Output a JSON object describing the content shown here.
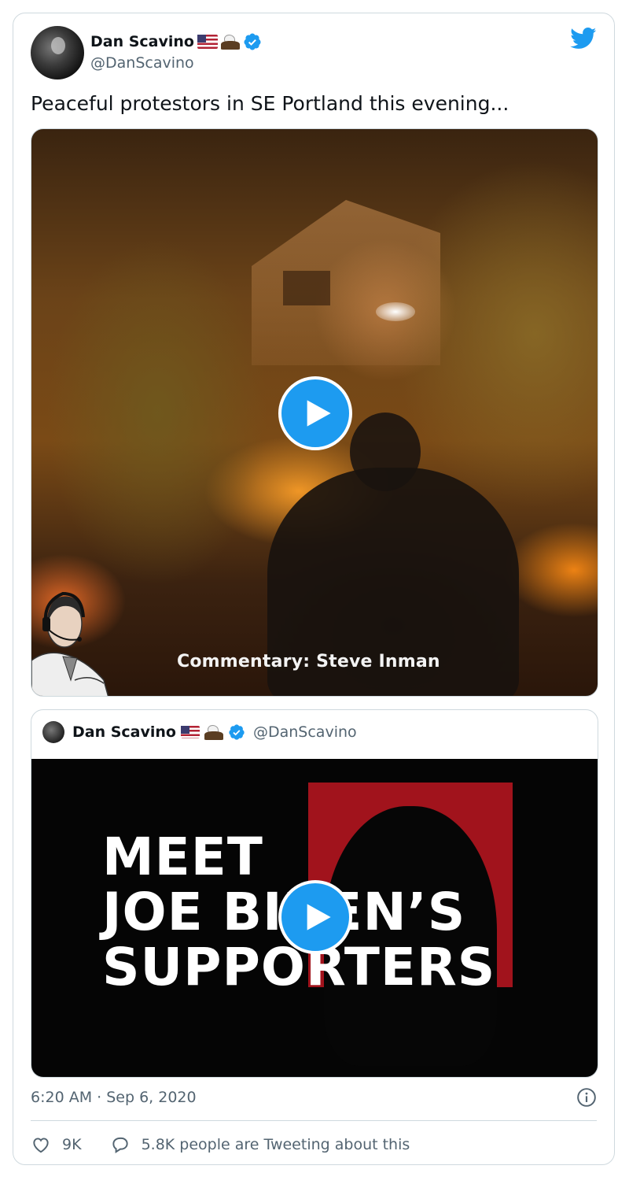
{
  "author": {
    "display_name": "Dan Scavino",
    "handle": "@DanScavino",
    "verified": true,
    "name_emojis": [
      "us-flag-emoji",
      "eagle-emoji"
    ]
  },
  "tweet": {
    "text": "Peaceful protestors in SE Portland this evening...",
    "timestamp": "6:20 AM · Sep 6, 2020"
  },
  "media": {
    "video_caption": "Commentary: Steve Inman"
  },
  "quoted_tweet": {
    "display_name": "Dan Scavino",
    "handle": "@DanScavino",
    "video_headline": [
      "MEET",
      "JOE BIDEN’S",
      "SUPPORTERS"
    ]
  },
  "actions": {
    "likes": "9K",
    "conversation": "5.8K people are Tweeting about this"
  },
  "colors": {
    "accent": "#1d9bf0",
    "text_primary": "#0f1419",
    "text_secondary": "#536471",
    "border": "#cfd9de"
  }
}
